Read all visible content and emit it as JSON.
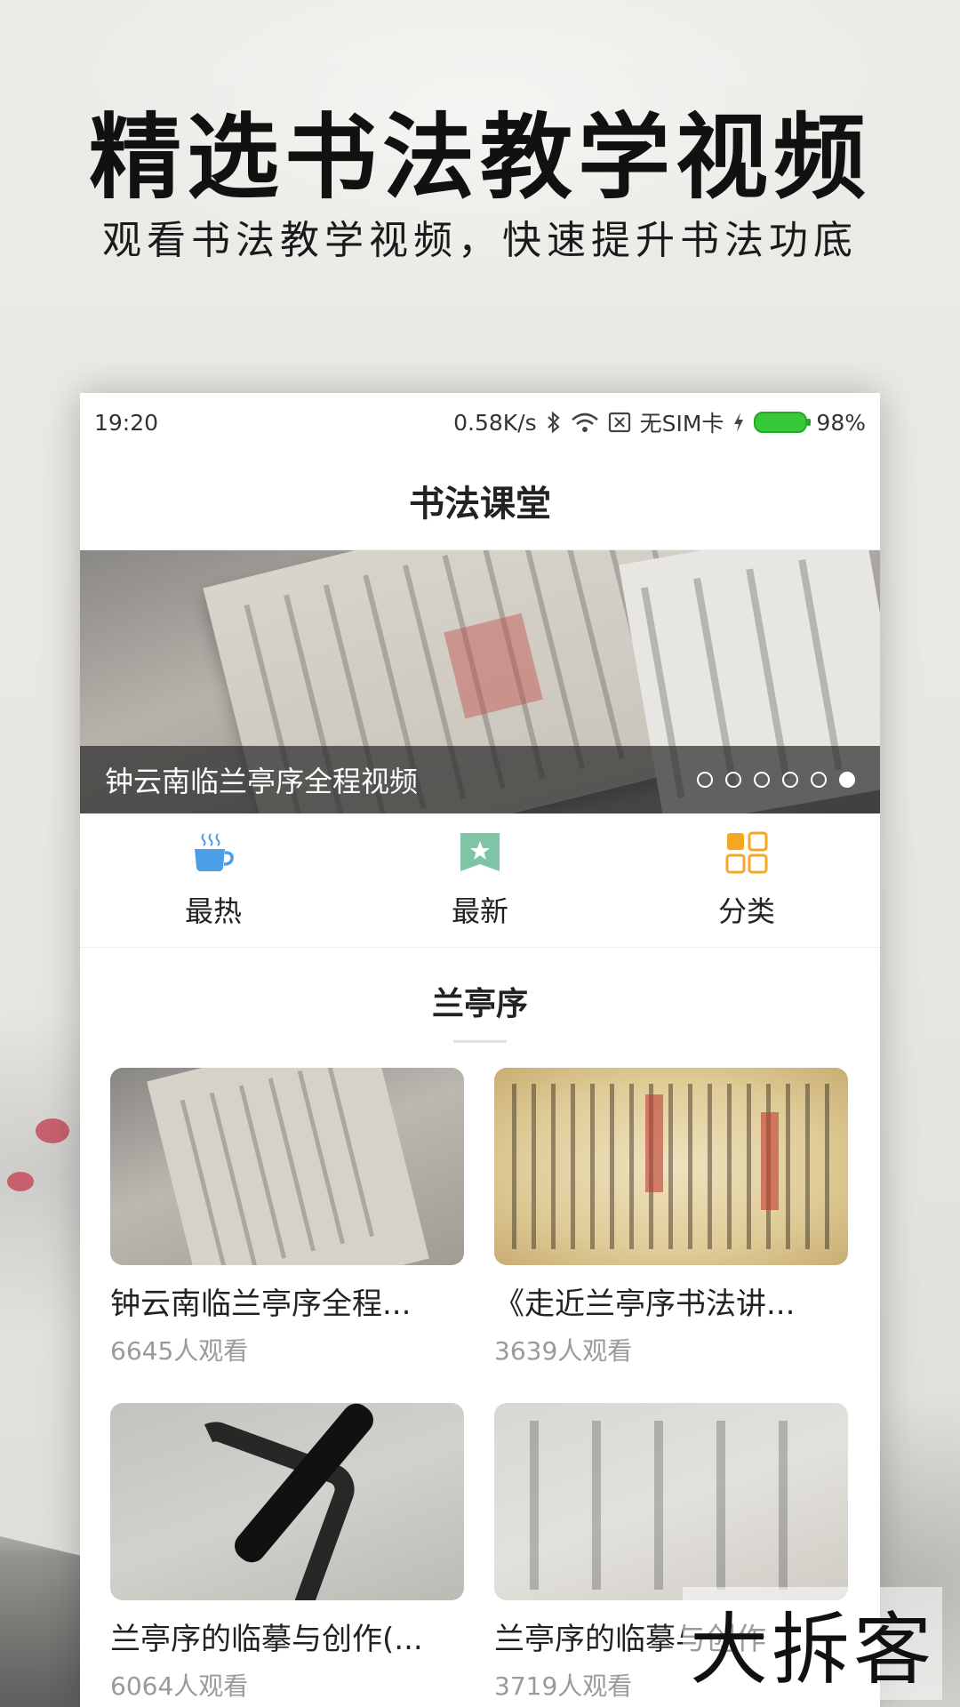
{
  "promo": {
    "headline": "精选书法教学视频",
    "subhead": "观看书法教学视频，快速提升书法功底"
  },
  "status_bar": {
    "time": "19:20",
    "speed": "0.58K/s",
    "sim": "无SIM卡",
    "battery": "98%",
    "icons": [
      "bluetooth-icon",
      "wifi-icon",
      "no-sim-icon",
      "charging-icon",
      "battery-icon"
    ]
  },
  "app": {
    "title": "书法课堂"
  },
  "banner": {
    "caption": "钟云南临兰亭序全程视频",
    "dot_count": 6,
    "active_dot": 6
  },
  "categories": [
    {
      "label": "最热",
      "icon": "coffee-cup-icon",
      "color": "#4a9fe6"
    },
    {
      "label": "最新",
      "icon": "star-badge-icon",
      "color": "#7fc4a4"
    },
    {
      "label": "分类",
      "icon": "grid-icon",
      "color": "#f5a623"
    }
  ],
  "section": {
    "title": "兰亭序"
  },
  "videos": [
    {
      "title": "钟云南临兰亭序全程...",
      "views": "6645人观看"
    },
    {
      "title": "《走近兰亭序书法讲...",
      "views": "3639人观看"
    },
    {
      "title": "兰亭序的临摹与创作(...",
      "views": "6064人观看"
    },
    {
      "title": "兰亭序的临摹与创作",
      "views": "3719人观看"
    }
  ],
  "watermark": "大拆客"
}
